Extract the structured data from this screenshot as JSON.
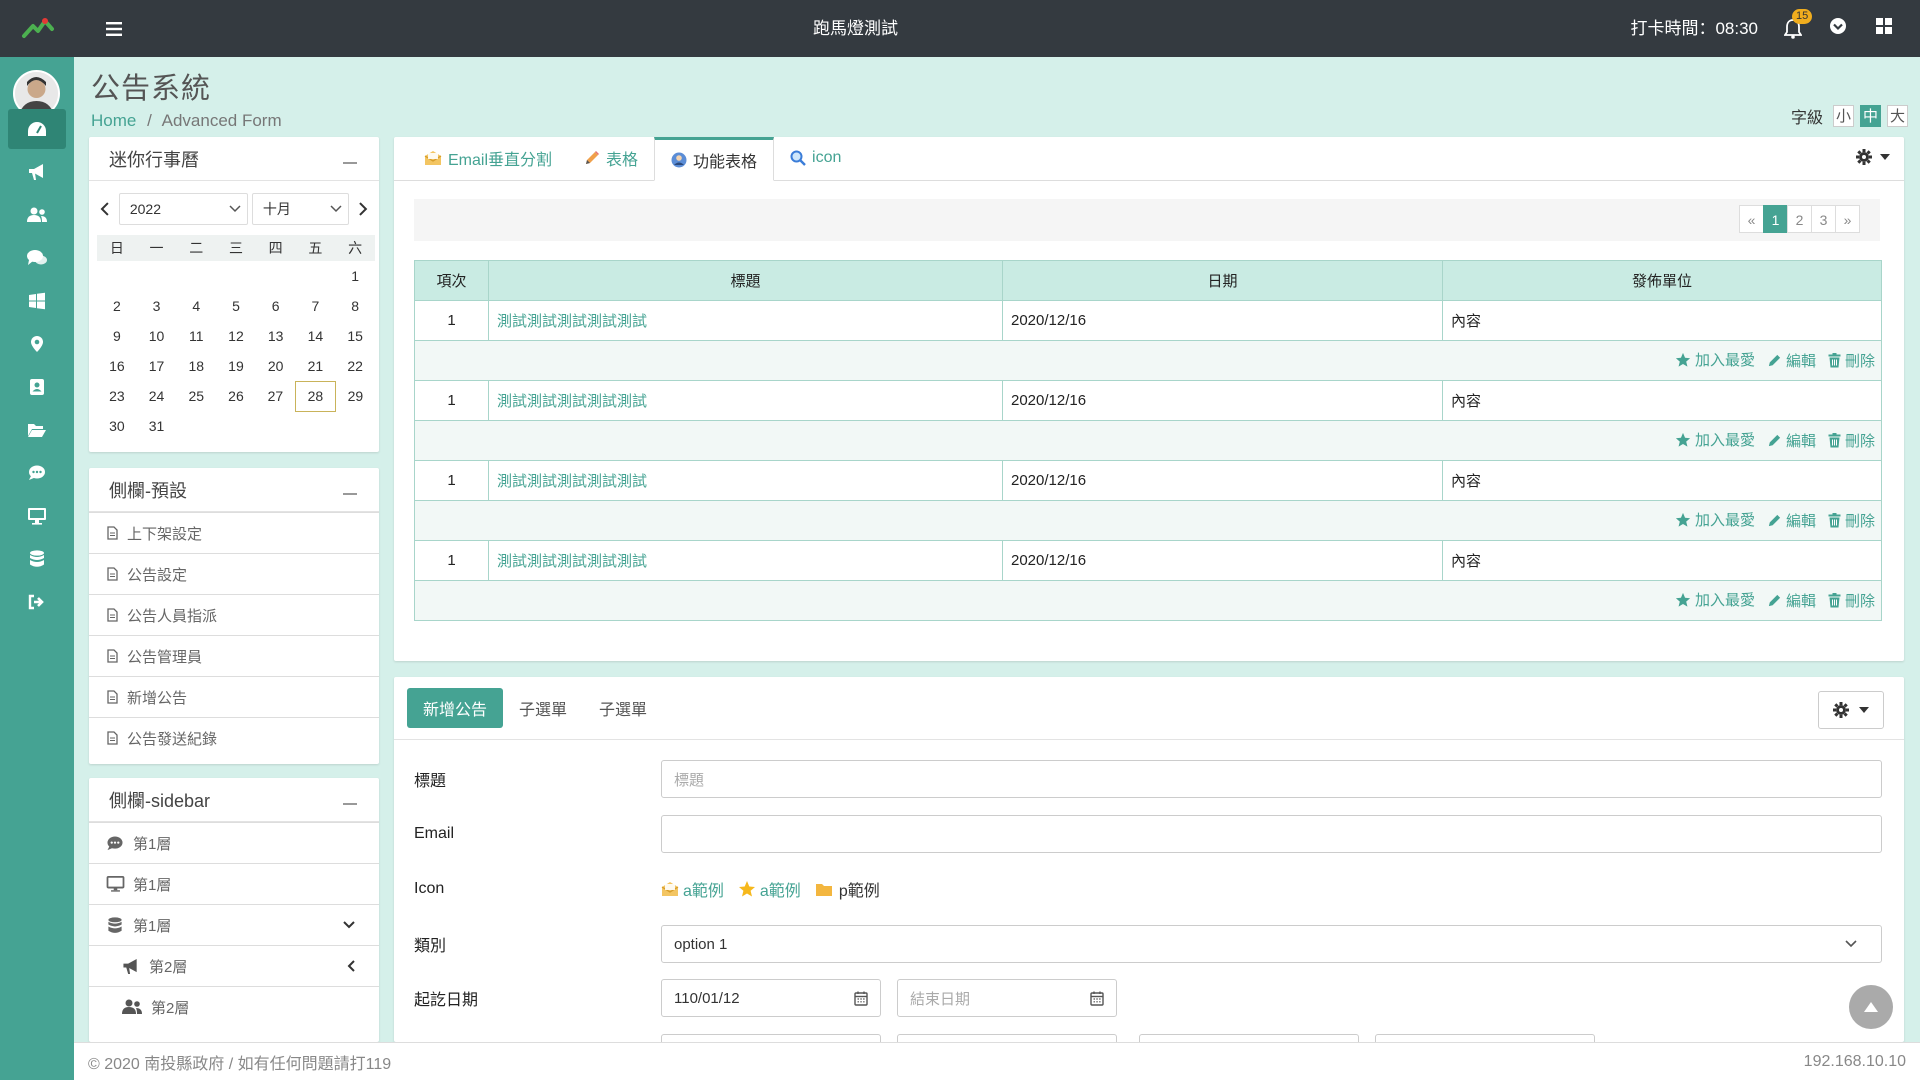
{
  "topbar": {
    "title": "跑馬燈測試",
    "clock": "打卡時間：08:30",
    "notification_count": "15"
  },
  "sidebar": {
    "icons": [
      "dashboard-icon",
      "bullhorn-icon",
      "users-icon",
      "comments-icon",
      "windows-icon",
      "map-marker-icon",
      "address-book-icon",
      "folder-open-icon",
      "comment-dots-icon",
      "desktop-icon",
      "database-icon",
      "sign-out-icon"
    ]
  },
  "page": {
    "title": "公告系統",
    "breadcrumb_home": "Home",
    "breadcrumb_sep": "/",
    "breadcrumb_current": "Advanced Form"
  },
  "fontsize": {
    "label": "字級",
    "small": "小",
    "medium": "中",
    "large": "大"
  },
  "calendar": {
    "title": "迷你行事曆",
    "year": "2022",
    "month": "十月",
    "weekdays": [
      "日",
      "一",
      "二",
      "三",
      "四",
      "五",
      "六"
    ],
    "weeks": [
      [
        "",
        "",
        "",
        "",
        "",
        "",
        "1"
      ],
      [
        "2",
        "3",
        "4",
        "5",
        "6",
        "7",
        "8"
      ],
      [
        "9",
        "10",
        "11",
        "12",
        "13",
        "14",
        "15"
      ],
      [
        "16",
        "17",
        "18",
        "19",
        "20",
        "21",
        "22"
      ],
      [
        "23",
        "24",
        "25",
        "26",
        "27",
        "28",
        "29"
      ],
      [
        "30",
        "31",
        "",
        "",
        "",
        "",
        ""
      ]
    ],
    "today": "28"
  },
  "preset_panel": {
    "title": "側欄-預設",
    "items": [
      "上下架設定",
      "公告設定",
      "公告人員指派",
      "公告管理員",
      "新增公告",
      "公告發送紀錄"
    ]
  },
  "sidebar_panel": {
    "title": "側欄-sidebar",
    "items": [
      "第1層",
      "第1層",
      "第1層",
      "第2層",
      "第2層"
    ]
  },
  "tabs": {
    "items": [
      "Email垂直分割",
      "表格",
      "功能表格",
      "icon"
    ],
    "active": 2
  },
  "pager": {
    "prev": "«",
    "pages": [
      "1",
      "2",
      "3"
    ],
    "next": "»",
    "current": "1"
  },
  "table": {
    "headers": [
      "項次",
      "標題",
      "日期",
      "發佈單位"
    ],
    "rows": [
      {
        "no": "1",
        "title": "測試測試測試測試測試",
        "date": "2020/12/16",
        "unit": "內容"
      },
      {
        "no": "1",
        "title": "測試測試測試測試測試",
        "date": "2020/12/16",
        "unit": "內容"
      },
      {
        "no": "1",
        "title": "測試測試測試測試測試",
        "date": "2020/12/16",
        "unit": "內容"
      },
      {
        "no": "1",
        "title": "測試測試測試測試測試",
        "date": "2020/12/16",
        "unit": "內容"
      }
    ],
    "actions": {
      "favorite": "加入最愛",
      "edit": "編輯",
      "delete": "刪除"
    }
  },
  "form": {
    "buttons": {
      "new": "新增公告",
      "sub1": "子選單",
      "sub2": "子選單"
    },
    "title_label": "標題",
    "title_placeholder": "標題",
    "email_label": "Email",
    "icon_label": "Icon",
    "icon_a1": "a範例",
    "icon_a2": "a範例",
    "icon_p": "p範例",
    "category_label": "類別",
    "category_value": "option 1",
    "date_label": "起訖日期",
    "start_date": "110/01/12",
    "end_placeholder": "結束日期"
  },
  "footer": {
    "left": "© 2020 南投縣政府 / 如有任何問題請打119",
    "right": "192.168.10.10"
  }
}
